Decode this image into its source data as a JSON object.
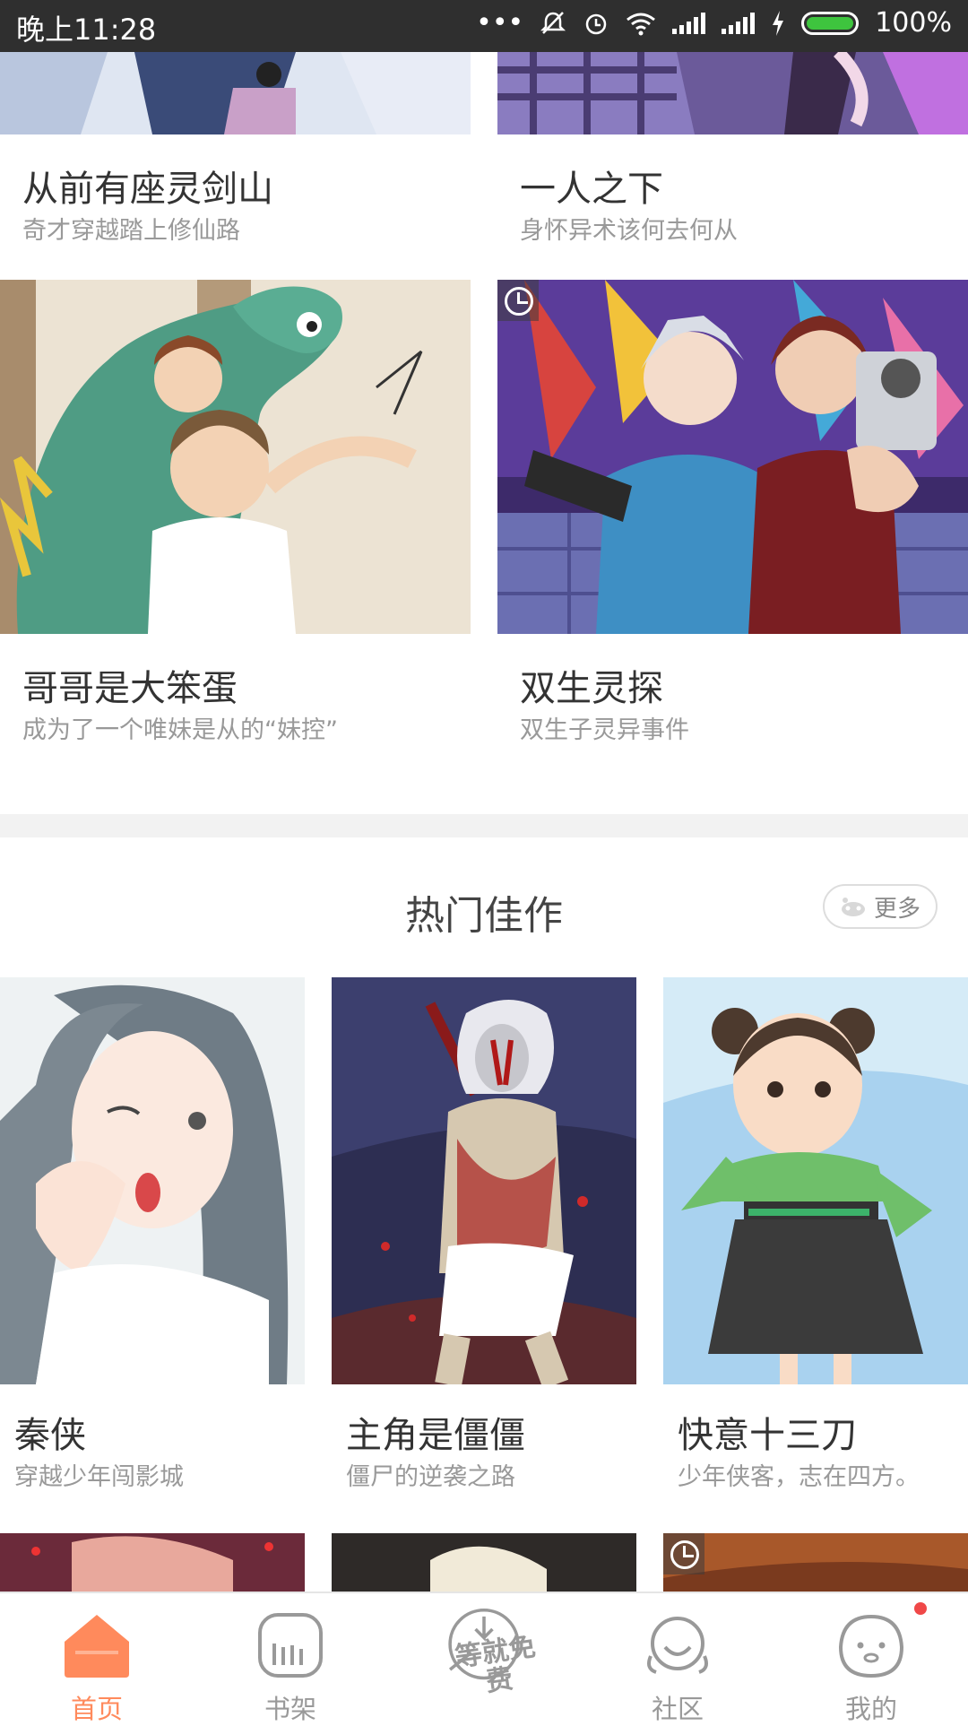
{
  "status_bar": {
    "time": "晚上11:28",
    "battery": "100%",
    "dots": "•••"
  },
  "grid_top": [
    {
      "title": "从前有座灵剑山",
      "subtitle": "奇才穿越踏上修仙路"
    },
    {
      "title": "一人之下",
      "subtitle": "身怀异术该何去何从"
    },
    {
      "title": "哥哥是大笨蛋",
      "subtitle": "成为了一个唯妹是从的“妹控”"
    },
    {
      "title": "双生灵探",
      "subtitle": "双生子灵异事件"
    }
  ],
  "hot_section": {
    "title": "热门佳作",
    "more_label": "更多"
  },
  "hot_items": [
    {
      "title": "秦侠",
      "subtitle": "穿越少年闯影城"
    },
    {
      "title": "主角是僵僵",
      "subtitle": "僵尸的逆袭之路"
    },
    {
      "title": "快意十三刀",
      "subtitle": "少年侠客，志在四方。"
    }
  ],
  "tabs": [
    {
      "label": "首页",
      "icon": "home-icon",
      "active": true
    },
    {
      "label": "书架",
      "icon": "bookshelf-icon"
    },
    {
      "label": "等就免费",
      "icon": "wait-free-icon"
    },
    {
      "label": "社区",
      "icon": "community-icon"
    },
    {
      "label": "我的",
      "icon": "profile-icon"
    }
  ],
  "colors": {
    "accent": "#ff8a5c",
    "notify": "#f04848",
    "statusbar": "#2f2f2f"
  }
}
